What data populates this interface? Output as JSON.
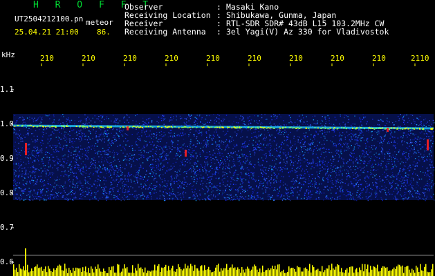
{
  "app": {
    "title": "H R O F F T"
  },
  "file": {
    "name": "UT2504212100.pn",
    "tag": "meteor",
    "datetime": "25.04.21 21:00",
    "count": "86."
  },
  "header": [
    {
      "key": "Observer",
      "value": "Masaki Kano"
    },
    {
      "key": "Receiving Location",
      "value": "Shibukawa, Gunma, Japan"
    },
    {
      "key": "Receiver",
      "value": "RTL-SDR SDR# 43dB L15 103.2MHz CW"
    },
    {
      "key": "Receiving Antenna",
      "value": "3el Yagi(V) Az 330 for Vladivostok"
    }
  ],
  "yaxis": {
    "unit": "kHz",
    "labels": [
      "1.1",
      "1.0",
      "0.9",
      "0.8",
      "0.7",
      "0.6"
    ],
    "values": [
      1.1,
      1.0,
      0.9,
      0.8,
      0.7,
      0.6
    ]
  },
  "xaxis": {
    "labels": [
      "210",
      "210",
      "210",
      "210",
      "210",
      "210",
      "210",
      "210",
      "210",
      "2110"
    ]
  },
  "colors": {
    "background": "#000000",
    "text": "#ffffff",
    "tick": "#ffff00",
    "title": "#00dd33",
    "noise": "#1e3cff",
    "carrier": "#ffff00",
    "meteor": "#ff2020",
    "baseline": "#ffff00"
  },
  "spectrogram": {
    "band_kHz": [
      0.78,
      1.03
    ],
    "carrier_kHz": 0.99
  }
}
